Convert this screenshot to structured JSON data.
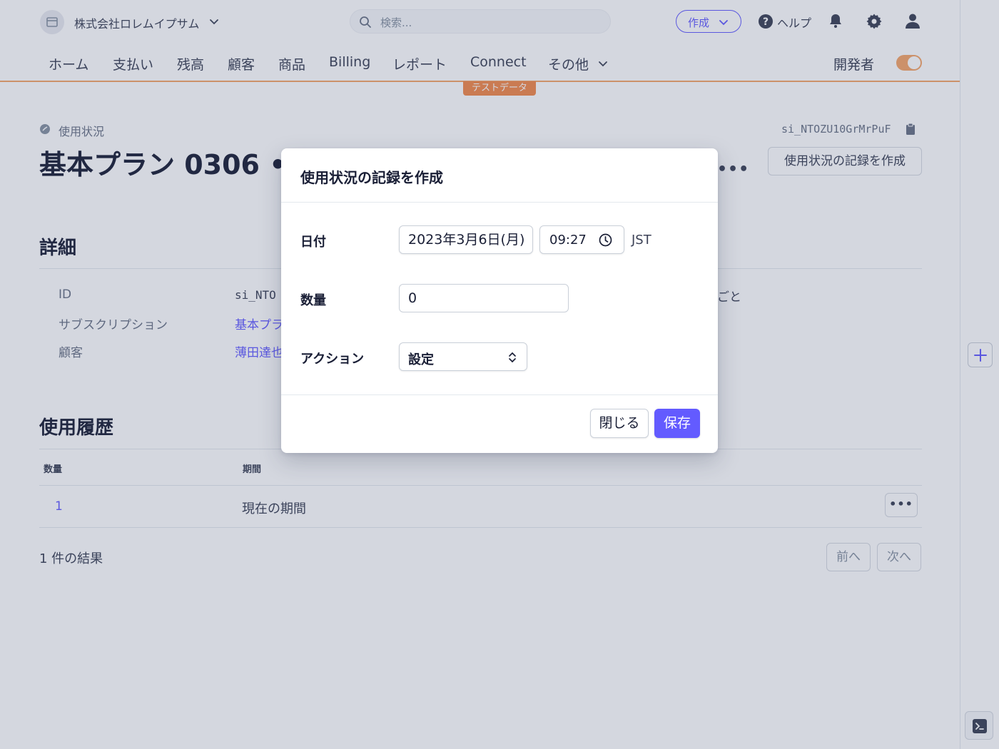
{
  "topbar": {
    "account_name": "株式会社ロレムイプサム",
    "search_placeholder": "検索...",
    "create_label": "作成",
    "help_label": "ヘルプ"
  },
  "nav": {
    "items": [
      "ホーム",
      "支払い",
      "残高",
      "顧客",
      "商品",
      "Billing",
      "レポート",
      "Connect",
      "その他"
    ],
    "developer_label": "開発者",
    "developer_toggle_on": true,
    "test_badge": "テストデータ"
  },
  "header": {
    "breadcrumb": "使用状況",
    "object_id": "si_NTOZU10GrMrPuF",
    "title": "基本プラン 0306 • ",
    "more": "•••",
    "create_record_button": "使用状況の記録を作成"
  },
  "details": {
    "section_title": "詳細",
    "rows": [
      {
        "label": "ID",
        "value": "si_NTO"
      },
      {
        "label": "サブスクリプション",
        "value": "基本プラ"
      },
      {
        "label": "顧客",
        "value": "薄田達也"
      }
    ],
    "extra_text": "ごと"
  },
  "history": {
    "section_title": "使用履歴",
    "columns": [
      "数量",
      "期間"
    ],
    "rows": [
      {
        "quantity": "1",
        "period": "現在の期間",
        "more": "•••"
      }
    ],
    "results_text": "1 件の結果",
    "prev_label": "前へ",
    "next_label": "次へ"
  },
  "modal": {
    "title": "使用状況の記録を作成",
    "date_label": "日付",
    "date_value": "2023年3月6日(月)",
    "time_value": "09:27",
    "timezone": "JST",
    "quantity_label": "数量",
    "quantity_value": "0",
    "action_label": "アクション",
    "action_value": "設定",
    "close_label": "閉じる",
    "save_label": "保存"
  },
  "colors": {
    "accent": "#635bff",
    "test_mode": "#f3894b"
  }
}
